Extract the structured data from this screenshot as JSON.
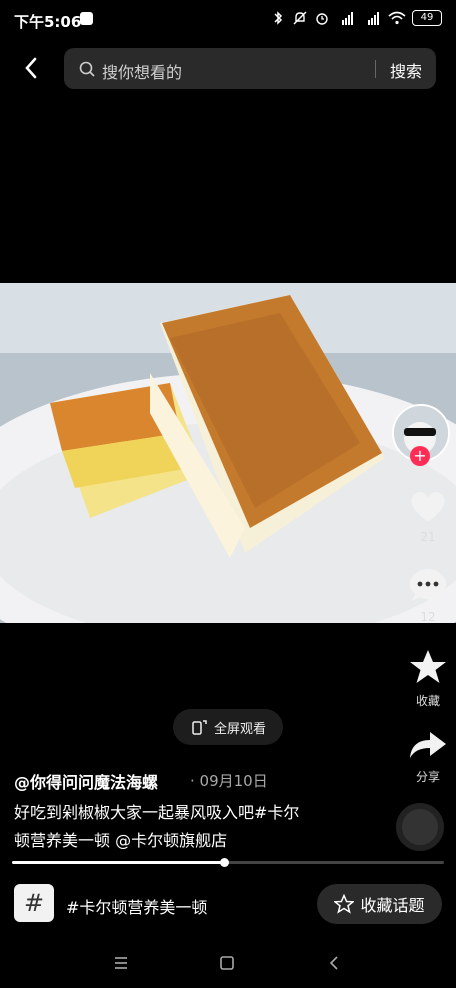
{
  "status_bar": {
    "time": "下午5:06",
    "battery": "49"
  },
  "search": {
    "placeholder": "搜你想看的",
    "button": "搜索"
  },
  "actions": {
    "likes": "21",
    "comments": "12",
    "collect_label": "收藏",
    "share_label": "分享"
  },
  "fullscreen_label": "全屏观看",
  "post": {
    "author": "@你得问问魔法海螺",
    "date": "· 09月10日",
    "description_line1": "好吃到剁椒椒大家一起暴风吸入吧#卡尔",
    "description_line2": "顿营养美一顿 @卡尔顿旗舰店"
  },
  "playback": {
    "progress": 0.49
  },
  "topic": {
    "icon_text": "#",
    "name": "#卡尔顿营养美一顿",
    "collect_label": "收藏话题"
  },
  "colors": {
    "accent": "#ff2d55",
    "background": "#000000"
  }
}
